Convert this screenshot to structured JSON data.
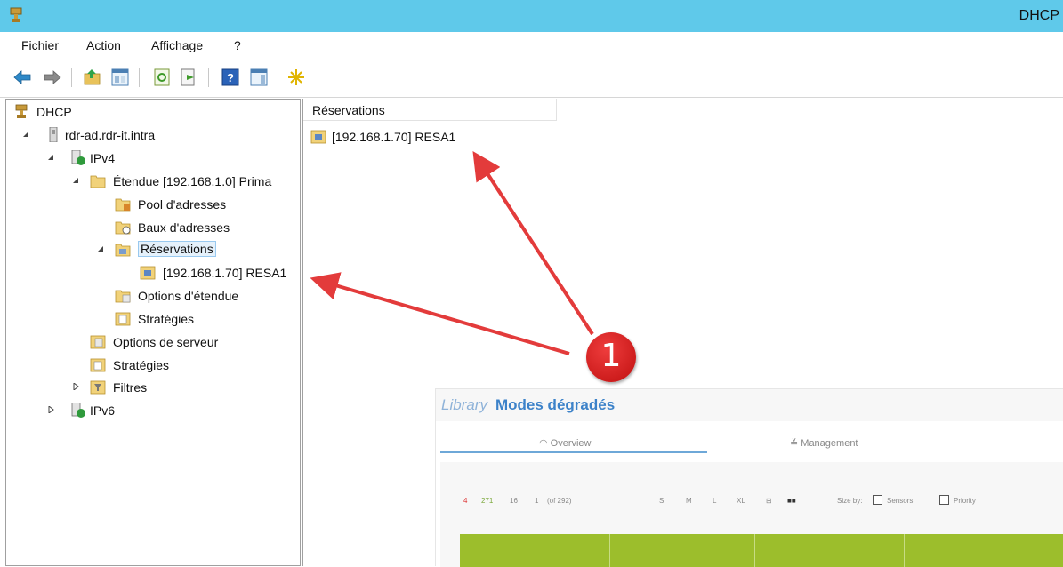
{
  "window": {
    "title": "DHCP"
  },
  "menu": [
    "Fichier",
    "Action",
    "Affichage",
    "?"
  ],
  "toolbar": [
    "back-icon",
    "forward-icon",
    "up-folder-icon",
    "show-hide-tree-icon",
    "refresh-icon",
    "export-list-icon",
    "help-icon",
    "show-hide-action-pane-icon",
    "new-icon"
  ],
  "tree": {
    "root": "DHCP",
    "server": "rdr-ad.rdr-it.intra",
    "ipv4": "IPv4",
    "scope": "Étendue [192.168.1.0] Prima",
    "pool": "Pool d'adresses",
    "leases": "Baux d'adresses",
    "reservations": "Réservations",
    "reservation_item": "[192.168.1.70] RESA1",
    "scope_options": "Options d'étendue",
    "scope_policies": "Stratégies",
    "server_options": "Options de serveur",
    "server_policies": "Stratégies",
    "filters": "Filtres",
    "ipv6": "IPv6"
  },
  "list": {
    "column_header": "Réservations",
    "rows": [
      "[192.168.1.70] RESA1"
    ]
  },
  "annotation": {
    "badge": "1",
    "color": "#e33b3b"
  },
  "overlay": {
    "title_prefix": "Library",
    "title_main": "Modes dégradés",
    "tab_overview": "Overview",
    "tab_management": "Management",
    "stats": [
      "4",
      "271",
      "16",
      "1",
      "(of 292)"
    ],
    "sizes": [
      "S",
      "M",
      "L",
      "XL"
    ],
    "size_by_label": "Size by:",
    "option_sensors": "Sensors",
    "option_priority": "Priority"
  },
  "colors": {
    "titlebar": "#5fc9ea",
    "selection": "#e5f1fb",
    "overlay_bar": "#9cbe2c",
    "overlay_title": "#3c82c9"
  }
}
